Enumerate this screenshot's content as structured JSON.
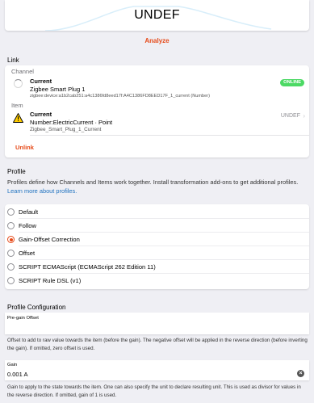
{
  "state": {
    "value": "UNDEF",
    "analyze_label": "Analyze"
  },
  "link": {
    "section_title": "Link",
    "channel_label": "Channel",
    "channel": {
      "title": "Current",
      "name": "Zigbee Smart Plug 1",
      "uid": "zigbee:device:a1b2cab251:a4c1386fd8eed17f:A4C1386FD8EED17F_1_current (Number)",
      "status": "ONLINE",
      "status_color": "#4cd964"
    },
    "item_label": "Item",
    "item": {
      "title": "Current",
      "type": "Number:ElectricCurrent · Point",
      "name": "Zigbee_Smart_Plug_1_Current",
      "state": "UNDEF",
      "icon": "warning-icon"
    },
    "unlink_label": "Unlink"
  },
  "profile": {
    "section_title": "Profile",
    "description": "Profiles define how Channels and Items work together. Install transformation add-ons to get additional profiles.",
    "learn_more": "Learn more about profiles.",
    "options": [
      {
        "label": "Default",
        "selected": false
      },
      {
        "label": "Follow",
        "selected": false
      },
      {
        "label": "Gain-Offset Correction",
        "selected": true
      },
      {
        "label": "Offset",
        "selected": false
      },
      {
        "label": "SCRIPT ECMAScript (ECMAScript 262 Edition 11)",
        "selected": false
      },
      {
        "label": "SCRIPT Rule DSL (v1)",
        "selected": false
      }
    ]
  },
  "config": {
    "section_title": "Profile Configuration",
    "pregain_label": "Pre-gain Offset",
    "pregain_help": "Offset to add to raw value towards the item (before the gain). The negative offset will be applied in the reverse direction (before inverting the gain). If omitted, zero offset is used.",
    "gain_label": "Gain",
    "gain_value": "0.001 A",
    "gain_help": "Gain to apply to the state towards the item. One can also specify the unit to declare resulting unit. This is used as divisor for values in the reverse direction. If omitted, gain of 1 is used."
  },
  "colors": {
    "accent": "#e64a19",
    "link": "#2073c0",
    "background": "#efeff4"
  }
}
